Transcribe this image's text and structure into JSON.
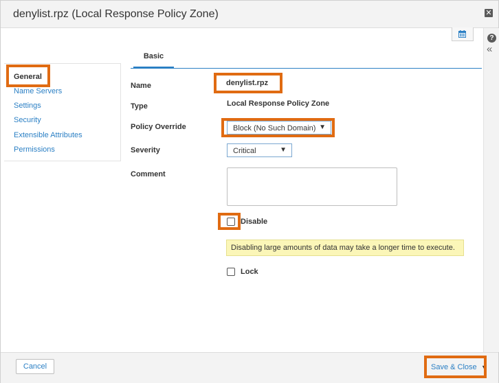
{
  "dialog": {
    "title": "denylist.rpz (Local Response Policy Zone)",
    "close_icon": "close-icon",
    "help_icon": "help-icon",
    "collapse_icon": "collapse-double-chevron-left-icon",
    "calendar_icon": "calendar-icon"
  },
  "sidebar": {
    "items": [
      {
        "label": "General",
        "active": true
      },
      {
        "label": "Name Servers"
      },
      {
        "label": "Settings"
      },
      {
        "label": "Security"
      },
      {
        "label": "Extensible Attributes"
      },
      {
        "label": "Permissions"
      }
    ]
  },
  "tabs": [
    {
      "label": "Basic",
      "active": true
    }
  ],
  "form": {
    "name_label": "Name",
    "name_value": "denylist.rpz",
    "type_label": "Type",
    "type_value": "Local Response Policy Zone",
    "policy_override_label": "Policy Override",
    "policy_override_value": "Block (No Such Domain)",
    "severity_label": "Severity",
    "severity_value": "Critical",
    "comment_label": "Comment",
    "comment_value": "",
    "disable_label": "Disable",
    "disable_checked": false,
    "warning_text": "Disabling large amounts of data may take a longer time to execute.",
    "lock_label": "Lock",
    "lock_checked": false
  },
  "footer": {
    "cancel_label": "Cancel",
    "save_close_label": "Save & Close"
  },
  "colors": {
    "accent": "#2a7fc4",
    "highlight": "#e06b12",
    "warning_bg": "#fbf6b8"
  }
}
